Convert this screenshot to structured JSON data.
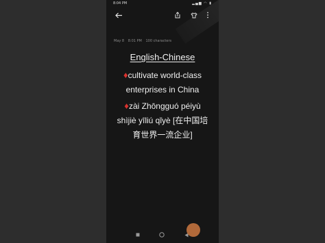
{
  "status": {
    "time": "8:04 PM",
    "icons": [
      "signal-icon",
      "wifi-icon",
      "battery-icon"
    ]
  },
  "toolbar": {
    "back_icon": "back-arrow-icon",
    "share_icon": "share-icon",
    "shirt_icon": "shirt-icon",
    "more_icon": "more-vertical-icon"
  },
  "meta": {
    "date": "May 8",
    "time": "8:01 PM",
    "chars": "100 characters"
  },
  "note": {
    "title": "English-Chinese",
    "line1_a": "cultivate world-class",
    "line1_b": "enterprises in China",
    "line2_a": "zài Zhōngguó péiyù",
    "line2_b": "shìjiè yīliú qǐyè [在中国培",
    "line2_c": "育世界一流企业]",
    "bullet_color": "#d8322e"
  },
  "nav": {
    "recents": "recents-icon",
    "home": "home-icon",
    "back": "back-triangle-icon"
  }
}
